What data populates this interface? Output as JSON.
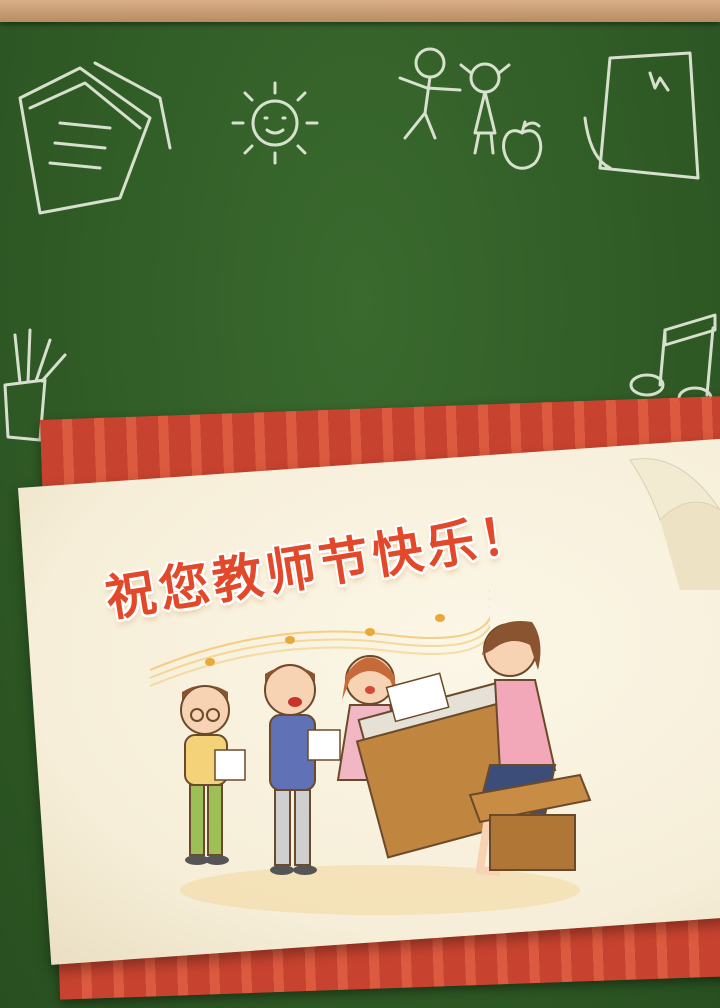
{
  "card": {
    "title": "祝您教师节快乐！"
  },
  "colors": {
    "chalkboard": "#2f5a25",
    "title": "#e2492a",
    "stripes": "#c8432f",
    "paper": "#f6eed8"
  },
  "decorations": [
    "books-doodle",
    "sun-doodle",
    "children-doodle",
    "apple-doodle",
    "notebook-doodle",
    "pencil-cup-doodle",
    "music-note-doodle"
  ]
}
